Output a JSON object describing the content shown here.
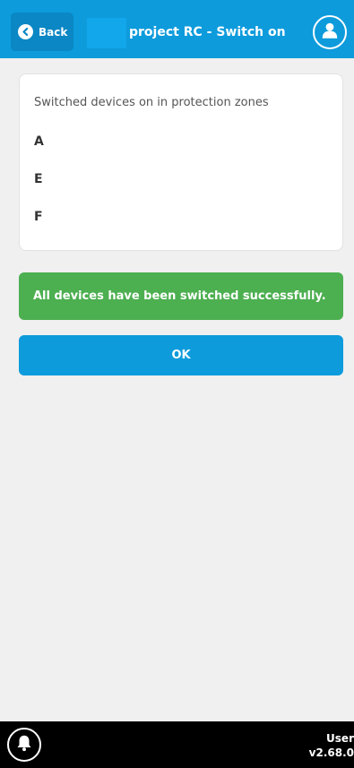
{
  "header": {
    "back_label": "Back",
    "title": "project RC - Switch on"
  },
  "card": {
    "label": "Switched devices on in protection zones",
    "zones": [
      "A",
      "E",
      "F"
    ]
  },
  "message": {
    "text": "All devices have been switched successfully."
  },
  "actions": {
    "ok_label": "OK"
  },
  "footer": {
    "user_label": "User",
    "version": "v2.68.0"
  },
  "colors": {
    "header": "#0d9bdc",
    "success": "#4caf50",
    "footer": "#000000"
  }
}
